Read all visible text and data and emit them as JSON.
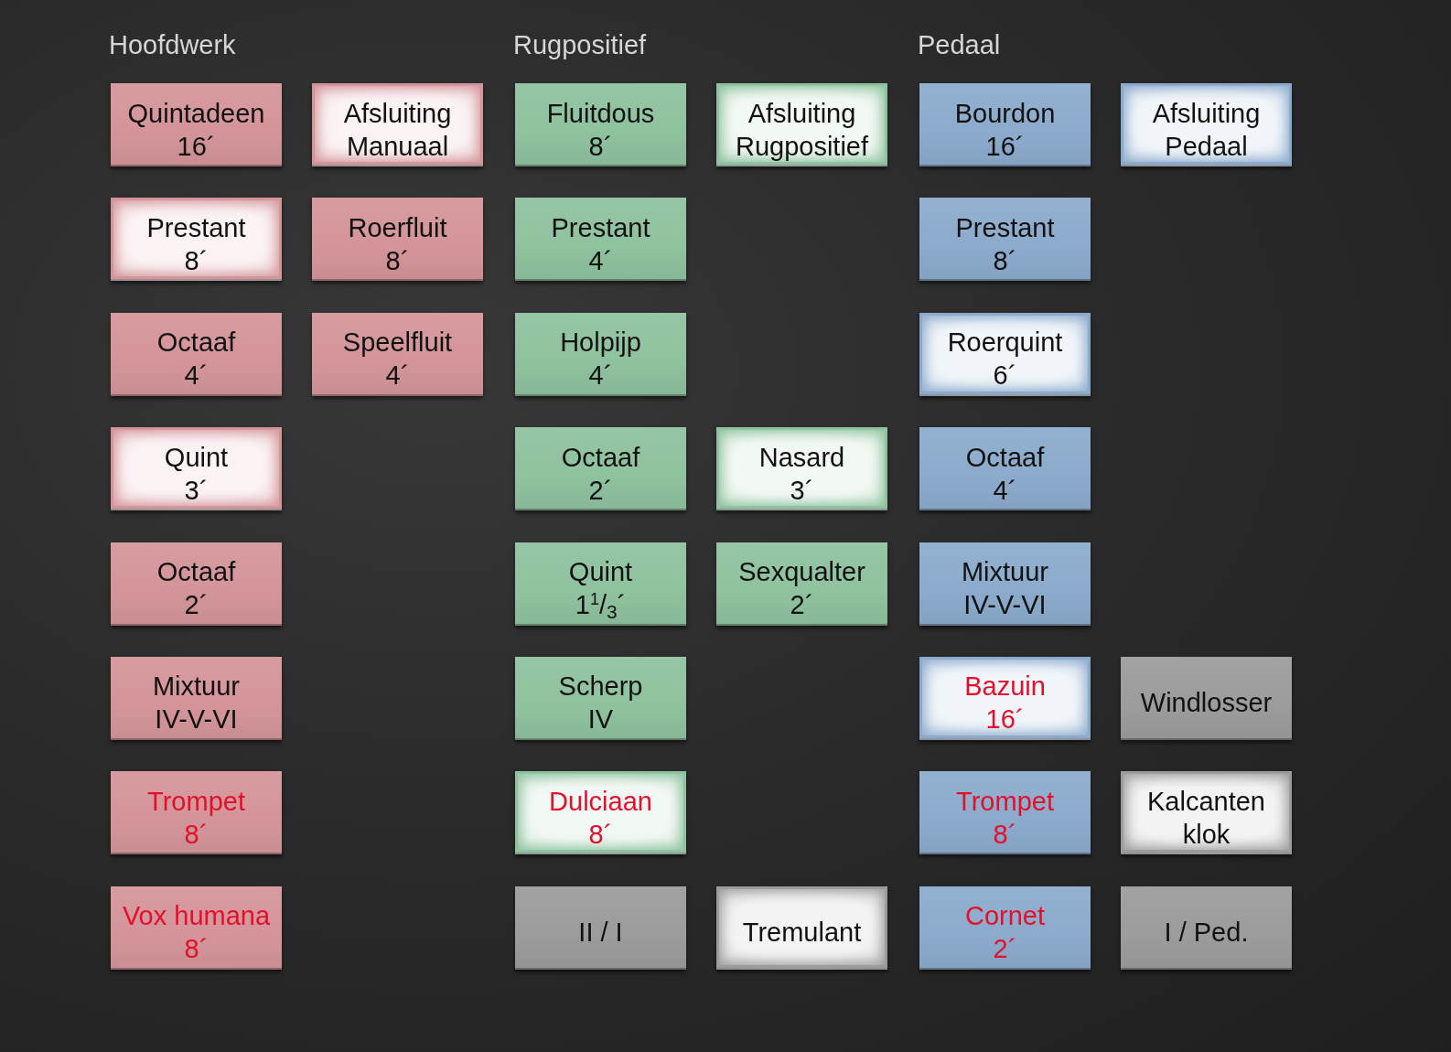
{
  "divisions": [
    {
      "title": "Hoofdwerk",
      "rows": [
        [
          {
            "name": "Quintadeen",
            "pitch": "16´",
            "on": false,
            "reed": false,
            "color": "#d4959a"
          },
          {
            "name": "Afsluiting Manuaal",
            "on": true,
            "reed": false,
            "color": "#d4959a"
          }
        ],
        [
          {
            "name": "Prestant",
            "pitch": "8´",
            "on": true,
            "reed": false,
            "color": "#d4959a"
          },
          {
            "name": "Roerfluit",
            "pitch": "8´",
            "on": false,
            "reed": false,
            "color": "#d4959a"
          }
        ],
        [
          {
            "name": "Octaaf",
            "pitch": "4´",
            "on": false,
            "reed": false,
            "color": "#d4959a"
          },
          {
            "name": "Speelfluit",
            "pitch": "4´",
            "on": false,
            "reed": false,
            "color": "#d4959a"
          }
        ],
        [
          {
            "name": "Quint",
            "pitch": "3´",
            "on": true,
            "reed": false,
            "color": "#d4959a"
          }
        ],
        [
          {
            "name": "Octaaf",
            "pitch": "2´",
            "on": false,
            "reed": false,
            "color": "#d4959a"
          }
        ],
        [
          {
            "name": "Mixtuur",
            "pitch": "IV-V-VI",
            "on": false,
            "reed": false,
            "color": "#d4959a"
          }
        ],
        [
          {
            "name": "Trompet",
            "pitch": "8´",
            "on": false,
            "reed": true,
            "color": "#d4959a"
          }
        ],
        [
          {
            "name": "Vox humana",
            "pitch": "8´",
            "on": false,
            "reed": true,
            "color": "#d4959a"
          }
        ]
      ]
    },
    {
      "title": "Rugpositief",
      "rows": [
        [
          {
            "name": "Fluitdous",
            "pitch": "8´",
            "on": false,
            "reed": false,
            "color": "#8fc29f"
          },
          {
            "name": "Afsluiting Rugpositief",
            "on": true,
            "reed": false,
            "color": "#8fc29f"
          }
        ],
        [
          {
            "name": "Prestant",
            "pitch": "4´",
            "on": false,
            "reed": false,
            "color": "#8fc29f"
          }
        ],
        [
          {
            "name": "Holpijp",
            "pitch": "4´",
            "on": false,
            "reed": false,
            "color": "#8fc29f"
          }
        ],
        [
          {
            "name": "Octaaf",
            "pitch": "2´",
            "on": false,
            "reed": false,
            "color": "#8fc29f"
          },
          {
            "name": "Nasard",
            "pitch": "3´",
            "on": true,
            "reed": false,
            "color": "#8fc29f"
          }
        ],
        [
          {
            "name": "Quint",
            "pitch": "1$^{1}$/$_{3}$´",
            "on": false,
            "reed": false,
            "color": "#8fc29f"
          },
          {
            "name": "Sexqualter",
            "pitch": "2´",
            "on": false,
            "reed": false,
            "color": "#8fc29f"
          }
        ],
        [
          {
            "name": "Scherp",
            "pitch": "IV",
            "on": false,
            "reed": false,
            "color": "#8fc29f"
          }
        ],
        [
          {
            "name": "Dulciaan",
            "pitch": "8´",
            "on": true,
            "reed": true,
            "color": "#8fc29f"
          }
        ],
        [
          {
            "name": "II / I",
            "on": false,
            "reed": false,
            "color": "#9c9c9c"
          },
          {
            "name": "Tremulant",
            "on": true,
            "reed": false,
            "color": "#9c9c9c"
          }
        ]
      ]
    },
    {
      "title": "Pedaal",
      "rows": [
        [
          {
            "name": "Bourdon",
            "pitch": "16´",
            "on": false,
            "reed": false,
            "color": "#8cabcc"
          },
          {
            "name": "Afsluiting Pedaal",
            "on": true,
            "reed": false,
            "color": "#8cabcc"
          }
        ],
        [
          {
            "name": "Prestant",
            "pitch": "8´",
            "on": false,
            "reed": false,
            "color": "#8cabcc"
          }
        ],
        [
          {
            "name": "Roerquint",
            "pitch": "6´",
            "on": true,
            "reed": false,
            "color": "#8cabcc"
          }
        ],
        [
          {
            "name": "Octaaf",
            "pitch": "4´",
            "on": false,
            "reed": false,
            "color": "#8cabcc"
          }
        ],
        [
          {
            "name": "Mixtuur",
            "pitch": "IV-V-VI",
            "on": false,
            "reed": false,
            "color": "#8cabcc"
          }
        ],
        [
          {
            "name": "Bazuin",
            "pitch": "16´",
            "on": true,
            "reed": true,
            "color": "#8cabcc"
          },
          {
            "name": "Windlosser",
            "on": false,
            "reed": false,
            "color": "#9c9c9c"
          }
        ],
        [
          {
            "name": "Trompet",
            "pitch": "8´",
            "on": false,
            "reed": true,
            "color": "#8cabcc"
          },
          {
            "name": "Kalcanten klok",
            "on": true,
            "reed": false,
            "color": "#9c9c9c"
          }
        ],
        [
          {
            "name": "Cornet",
            "pitch": "2´",
            "on": false,
            "reed": true,
            "color": "#8cabcc"
          },
          {
            "name": "I / Ped.",
            "on": false,
            "reed": false,
            "color": "#9c9c9c"
          }
        ]
      ]
    }
  ]
}
